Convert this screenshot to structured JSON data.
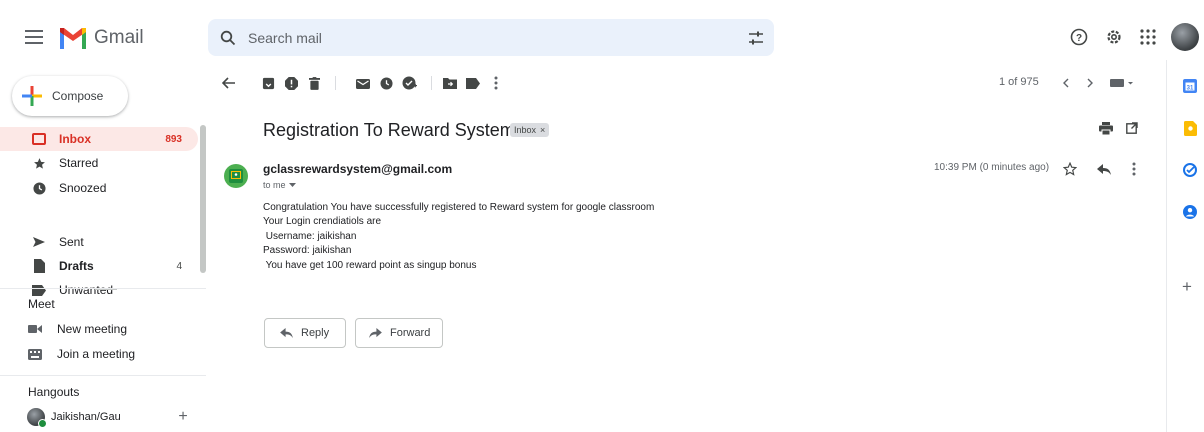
{
  "app": {
    "name": "Gmail"
  },
  "header": {
    "search_placeholder": "Search mail"
  },
  "compose": {
    "label": "Compose"
  },
  "nav": [
    {
      "label": "Inbox",
      "count": "893",
      "icon": "inbox-icon"
    },
    {
      "label": "Starred",
      "count": "",
      "icon": "star-icon"
    },
    {
      "label": "Snoozed",
      "count": "",
      "icon": "clock-icon"
    },
    {
      "label": "Sent",
      "count": "",
      "icon": "send-icon"
    },
    {
      "label": "Drafts",
      "count": "4",
      "icon": "file-icon"
    },
    {
      "label": "Unwanted",
      "count": "",
      "icon": "label-icon"
    }
  ],
  "meet": {
    "title": "Meet",
    "items": [
      {
        "label": "New meeting",
        "icon": "video-icon"
      },
      {
        "label": "Join a meeting",
        "icon": "keyboard-icon"
      }
    ]
  },
  "hangouts": {
    "title": "Hangouts",
    "user": "Jaikishan/Gaura"
  },
  "toolbar": {
    "pager": "1 of 975"
  },
  "message": {
    "subject": "Registration To Reward System",
    "label": "Inbox",
    "sender": "gclassrewardsystem@gmail.com",
    "to": "to me",
    "time": "10:39 PM (0 minutes ago)",
    "body": [
      "Congratulation You have successfully registered to Reward system for google classroom",
      "Your Login crendiatiols are",
      " Username: jaikishan",
      "Password: jaikishan",
      " You have get 100 reward point as singup bonus"
    ]
  },
  "actions": {
    "reply": "Reply",
    "forward": "Forward"
  },
  "colors": {
    "inbox_active": "#fce8e6",
    "accent_red": "#d93025",
    "search_bg": "#eaf1fb"
  }
}
